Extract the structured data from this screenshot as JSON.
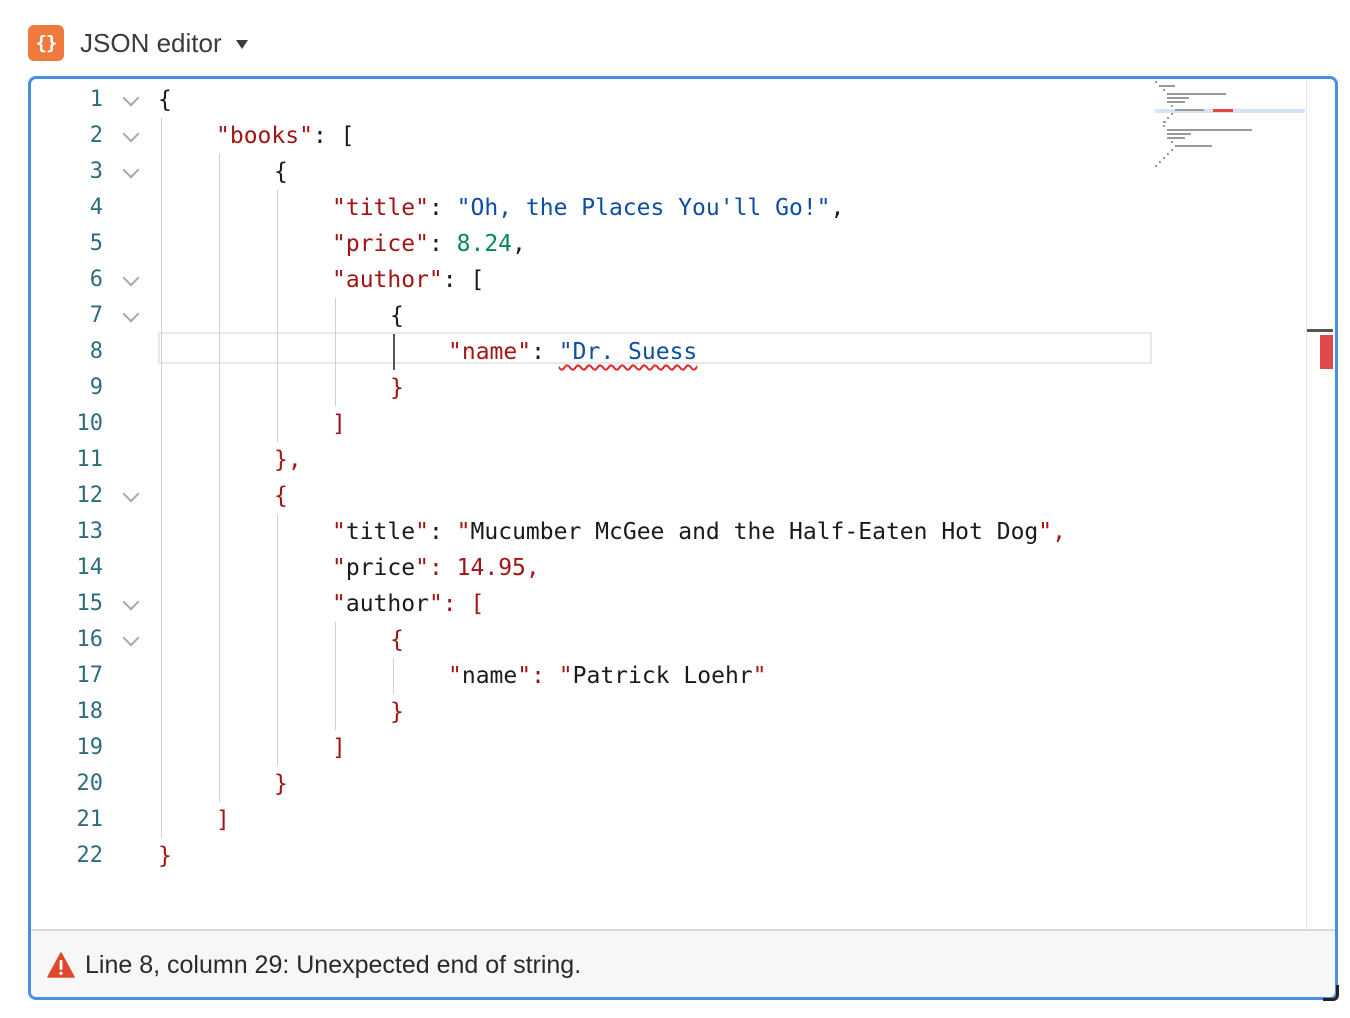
{
  "header": {
    "icon_glyph": "{}",
    "title": "JSON editor",
    "brand_color": "#f07a3e"
  },
  "editor": {
    "accent_color": "#4a90e2",
    "current_line": 8,
    "lines": [
      {
        "n": "1",
        "fold": true,
        "indent": 0,
        "tokens": [
          {
            "t": "p",
            "v": "{"
          }
        ]
      },
      {
        "n": "2",
        "fold": true,
        "indent": 1,
        "tokens": [
          {
            "t": "k",
            "v": "\"books\""
          },
          {
            "t": "p",
            "v": ": ["
          }
        ]
      },
      {
        "n": "3",
        "fold": true,
        "indent": 2,
        "tokens": [
          {
            "t": "p",
            "v": "{"
          }
        ]
      },
      {
        "n": "4",
        "fold": false,
        "indent": 3,
        "tokens": [
          {
            "t": "k",
            "v": "\"title\""
          },
          {
            "t": "p",
            "v": ": "
          },
          {
            "t": "s",
            "v": "\"Oh, the Places You'll Go!\""
          },
          {
            "t": "p",
            "v": ","
          }
        ]
      },
      {
        "n": "5",
        "fold": false,
        "indent": 3,
        "tokens": [
          {
            "t": "k",
            "v": "\"price\""
          },
          {
            "t": "p",
            "v": ": "
          },
          {
            "t": "n",
            "v": "8.24"
          },
          {
            "t": "p",
            "v": ","
          }
        ]
      },
      {
        "n": "6",
        "fold": true,
        "indent": 3,
        "tokens": [
          {
            "t": "k",
            "v": "\"author\""
          },
          {
            "t": "p",
            "v": ": ["
          }
        ]
      },
      {
        "n": "7",
        "fold": true,
        "indent": 4,
        "tokens": [
          {
            "t": "p",
            "v": "{"
          }
        ]
      },
      {
        "n": "8",
        "fold": false,
        "indent": 5,
        "tokens": [
          {
            "t": "k",
            "v": "\"name\""
          },
          {
            "t": "p",
            "v": ": "
          },
          {
            "t": "s err",
            "v": "\"Dr. Suess"
          }
        ]
      },
      {
        "n": "9",
        "fold": false,
        "indent": 4,
        "tokens": [
          {
            "t": "r",
            "v": "}"
          }
        ]
      },
      {
        "n": "10",
        "fold": false,
        "indent": 3,
        "tokens": [
          {
            "t": "r",
            "v": "]"
          }
        ]
      },
      {
        "n": "11",
        "fold": false,
        "indent": 2,
        "tokens": [
          {
            "t": "r",
            "v": "},"
          }
        ]
      },
      {
        "n": "12",
        "fold": true,
        "indent": 2,
        "tokens": [
          {
            "t": "r",
            "v": "{"
          }
        ]
      },
      {
        "n": "13",
        "fold": false,
        "indent": 3,
        "tokens": [
          {
            "t": "r",
            "v": "\""
          },
          {
            "t": "p",
            "v": "title"
          },
          {
            "t": "r",
            "v": "\""
          },
          {
            "t": "p",
            "v": ": "
          },
          {
            "t": "r",
            "v": "\""
          },
          {
            "t": "p",
            "v": "Mucumber McGee and the Half-Eaten Hot Dog"
          },
          {
            "t": "r",
            "v": "\","
          }
        ]
      },
      {
        "n": "14",
        "fold": false,
        "indent": 3,
        "tokens": [
          {
            "t": "r",
            "v": "\""
          },
          {
            "t": "p",
            "v": "price"
          },
          {
            "t": "r",
            "v": "\": 14.95,"
          }
        ]
      },
      {
        "n": "15",
        "fold": true,
        "indent": 3,
        "tokens": [
          {
            "t": "r",
            "v": "\""
          },
          {
            "t": "p",
            "v": "author"
          },
          {
            "t": "r",
            "v": "\": ["
          }
        ]
      },
      {
        "n": "16",
        "fold": true,
        "indent": 4,
        "tokens": [
          {
            "t": "r",
            "v": "{"
          }
        ]
      },
      {
        "n": "17",
        "fold": false,
        "indent": 5,
        "tokens": [
          {
            "t": "r",
            "v": "\""
          },
          {
            "t": "p",
            "v": "name"
          },
          {
            "t": "r",
            "v": "\": \""
          },
          {
            "t": "p",
            "v": "Patrick Loehr"
          },
          {
            "t": "r",
            "v": "\""
          }
        ]
      },
      {
        "n": "18",
        "fold": false,
        "indent": 4,
        "tokens": [
          {
            "t": "r",
            "v": "}"
          }
        ]
      },
      {
        "n": "19",
        "fold": false,
        "indent": 3,
        "tokens": [
          {
            "t": "r",
            "v": "]"
          }
        ]
      },
      {
        "n": "20",
        "fold": false,
        "indent": 2,
        "tokens": [
          {
            "t": "r",
            "v": "}"
          }
        ]
      },
      {
        "n": "21",
        "fold": false,
        "indent": 1,
        "tokens": [
          {
            "t": "r",
            "v": "]"
          }
        ]
      },
      {
        "n": "22",
        "fold": false,
        "indent": 0,
        "tokens": [
          {
            "t": "r",
            "v": "}"
          }
        ]
      }
    ]
  },
  "status": {
    "icon": "warning-triangle-icon",
    "message": "Line 8, column 29: Unexpected end of string.",
    "warning_color": "#e0482c"
  }
}
